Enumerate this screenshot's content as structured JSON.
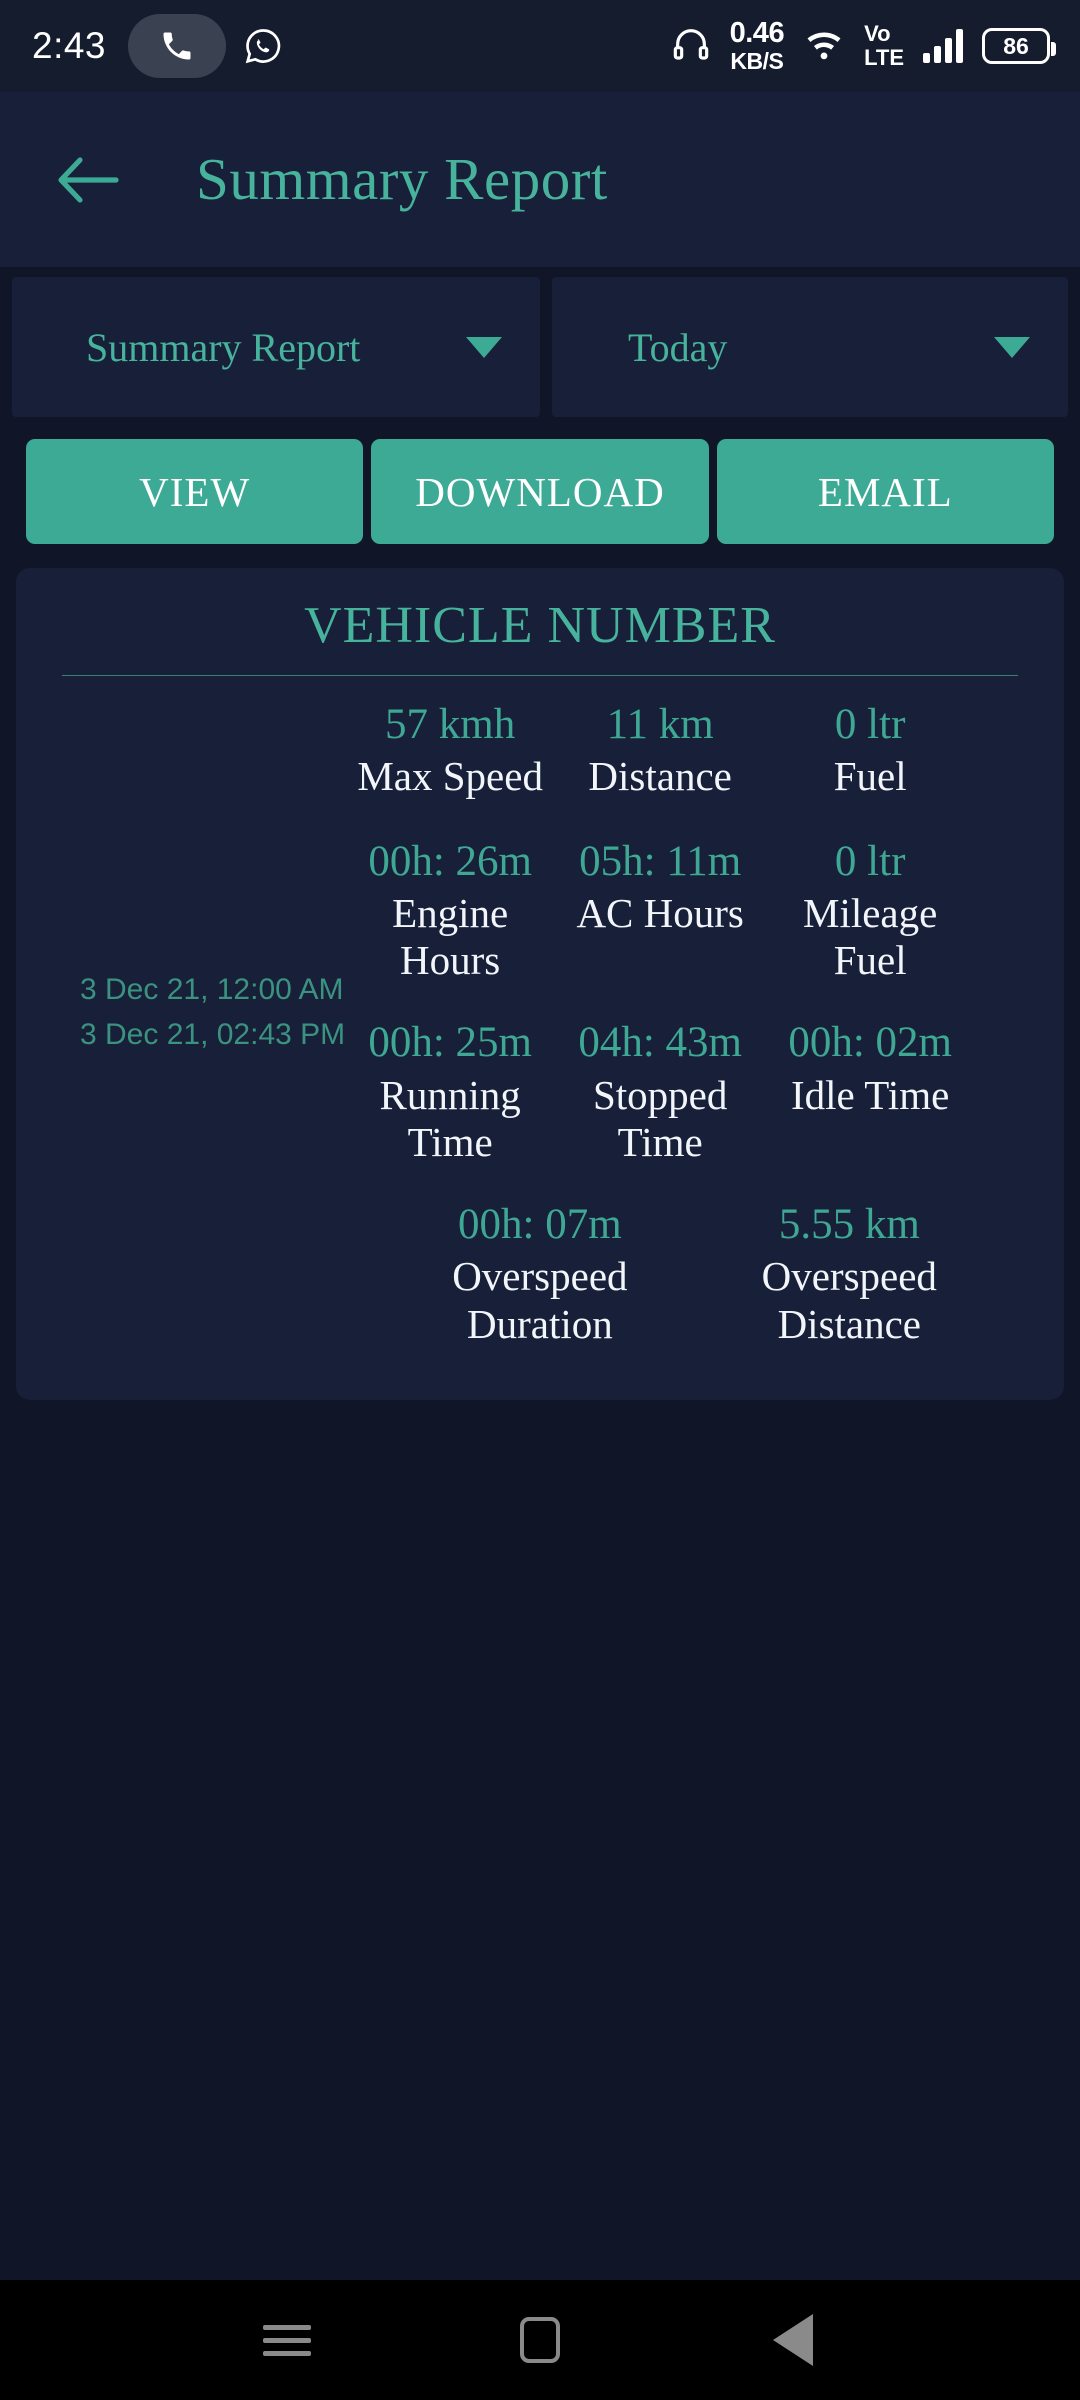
{
  "status_bar": {
    "time": "2:43",
    "icons_left": [
      "phone-icon",
      "whatsapp-icon"
    ],
    "headset_icon": "headset-icon",
    "net_speed_value": "0.46",
    "net_speed_unit": "KB/S",
    "wifi_icon": "wifi-icon",
    "volte_line1": "Vo",
    "volte_line2": "LTE",
    "signal_icon": "signal-bars-icon",
    "battery_level": "86"
  },
  "app_bar": {
    "back_icon": "back-arrow-icon",
    "title": "Summary Report"
  },
  "filters": {
    "report_type": {
      "value": "Summary Report",
      "caret_icon": "chevron-down-icon"
    },
    "period": {
      "value": "Today",
      "caret_icon": "chevron-down-icon"
    }
  },
  "actions": {
    "view": "VIEW",
    "download": "DOWNLOAD",
    "email": "EMAIL"
  },
  "report_card": {
    "title": "VEHICLE NUMBER",
    "date_from": "3 Dec 21, 12:00 AM",
    "date_to": "3 Dec 21, 02:43 PM",
    "stats": [
      [
        {
          "value": "57 kmh",
          "label": "Max Speed"
        },
        {
          "value": "11 km",
          "label": "Distance"
        },
        {
          "value": "0 ltr",
          "label": "Fuel"
        }
      ],
      [
        {
          "value": "00h: 26m",
          "label": "Engine Hours"
        },
        {
          "value": "05h: 11m",
          "label": "AC Hours"
        },
        {
          "value": "0 ltr",
          "label": "Mileage Fuel"
        }
      ],
      [
        {
          "value": "00h: 25m",
          "label": "Running Time"
        },
        {
          "value": "04h: 43m",
          "label": "Stopped Time"
        },
        {
          "value": "00h: 02m",
          "label": "Idle Time"
        }
      ],
      [
        {
          "value": "00h: 07m",
          "label": "Overspeed Duration"
        },
        {
          "value": "5.55 km",
          "label": "Overspeed Distance"
        }
      ]
    ]
  },
  "nav_bar": {
    "recents_icon": "recents-icon",
    "home_icon": "home-icon",
    "back_icon": "back-triangle-icon"
  },
  "colors": {
    "accent": "#3daa96",
    "accent_text": "#47b39c",
    "page_bg": "#101527",
    "surface": "#172038",
    "status_bg": "#151c2e",
    "label_text": "#f2f5fa",
    "date_text": "#3b9280"
  }
}
